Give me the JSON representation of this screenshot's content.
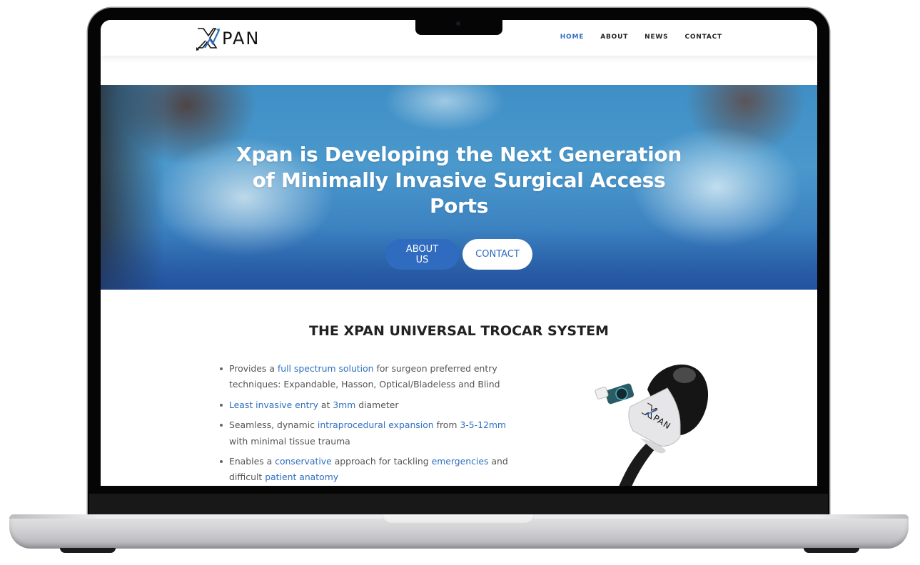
{
  "device": {
    "type": "laptop-mockup"
  },
  "site": {
    "brand": {
      "name": "PAN",
      "logo_icon": "xpan-x-arrow-icon"
    },
    "nav": [
      {
        "label": "HOME",
        "active": true
      },
      {
        "label": "ABOUT",
        "active": false
      },
      {
        "label": "NEWS",
        "active": false
      },
      {
        "label": "CONTACT",
        "active": false
      }
    ],
    "hero": {
      "title": "Xpan is Developing the Next Generation of Minimally Invasive Surgical Access Ports",
      "image_description": "surgeons in masks and caps, blue tint",
      "buttons": [
        {
          "label": "ABOUT US",
          "style": "primary"
        },
        {
          "label": "CONTACT",
          "style": "secondary"
        }
      ]
    },
    "section": {
      "title": "THE XPAN UNIVERSAL TROCAR SYSTEM",
      "features": [
        [
          {
            "text": "Provides a ",
            "hl": false
          },
          {
            "text": "full spectrum solution",
            "hl": true
          },
          {
            "text": " for surgeon preferred entry techniques: Expandable, Hasson, Optical/Bladeless and Blind",
            "hl": false
          }
        ],
        [
          {
            "text": "Least invasive entry",
            "hl": true
          },
          {
            "text": " at ",
            "hl": false
          },
          {
            "text": "3mm",
            "hl": true
          },
          {
            "text": " diameter",
            "hl": false
          }
        ],
        [
          {
            "text": "Seamless, dynamic ",
            "hl": false
          },
          {
            "text": "intraprocedural expansion",
            "hl": true
          },
          {
            "text": " from ",
            "hl": false
          },
          {
            "text": "3-5-12mm",
            "hl": true
          },
          {
            "text": " with minimal tissue trauma",
            "hl": false
          }
        ],
        [
          {
            "text": "Enables a ",
            "hl": false
          },
          {
            "text": "conservative",
            "hl": true
          },
          {
            "text": " approach for tackling ",
            "hl": false
          },
          {
            "text": "emergencies",
            "hl": true
          },
          {
            "text": " and difficult ",
            "hl": false
          },
          {
            "text": "patient anatomy",
            "hl": true
          }
        ]
      ],
      "product_image": {
        "label": "PAN",
        "description": "Xpan trocar device"
      }
    },
    "colors": {
      "accent": "#2e6fc1",
      "button_primary": "#2f6bbe",
      "text": "#555555",
      "heading": "#222222"
    }
  }
}
